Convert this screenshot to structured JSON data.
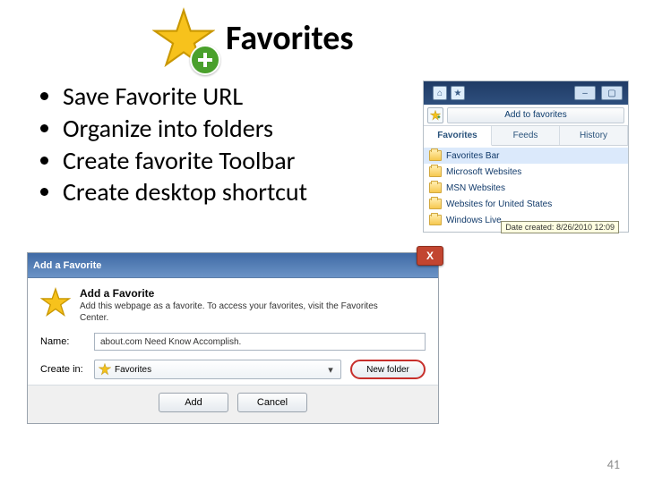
{
  "title": "Favorites",
  "bullets": [
    "Save Favorite URL",
    "Organize into folders",
    "Create favorite Toolbar",
    "Create desktop shortcut"
  ],
  "fav_pane": {
    "add_label": "Add to favorites",
    "tabs": {
      "favorites": "Favorites",
      "feeds": "Feeds",
      "history": "History"
    },
    "items": [
      {
        "label": "Favorites Bar",
        "selected": true
      },
      {
        "label": "Microsoft Websites"
      },
      {
        "label": "MSN Websites"
      },
      {
        "label": "Websites for United States"
      },
      {
        "label": "Windows Live"
      }
    ],
    "tooltip": "Date created: 8/26/2010 12:09"
  },
  "dialog": {
    "title": "Add a Favorite",
    "heading": "Add a Favorite",
    "subheading": "Add this webpage as a favorite. To access your favorites, visit the Favorites Center.",
    "name_label": "Name:",
    "name_value": "about.com Need Know Accomplish.",
    "createin_label": "Create in:",
    "createin_value": "Favorites",
    "newfolder": "New folder",
    "add": "Add",
    "cancel": "Cancel"
  },
  "page_number": "41"
}
